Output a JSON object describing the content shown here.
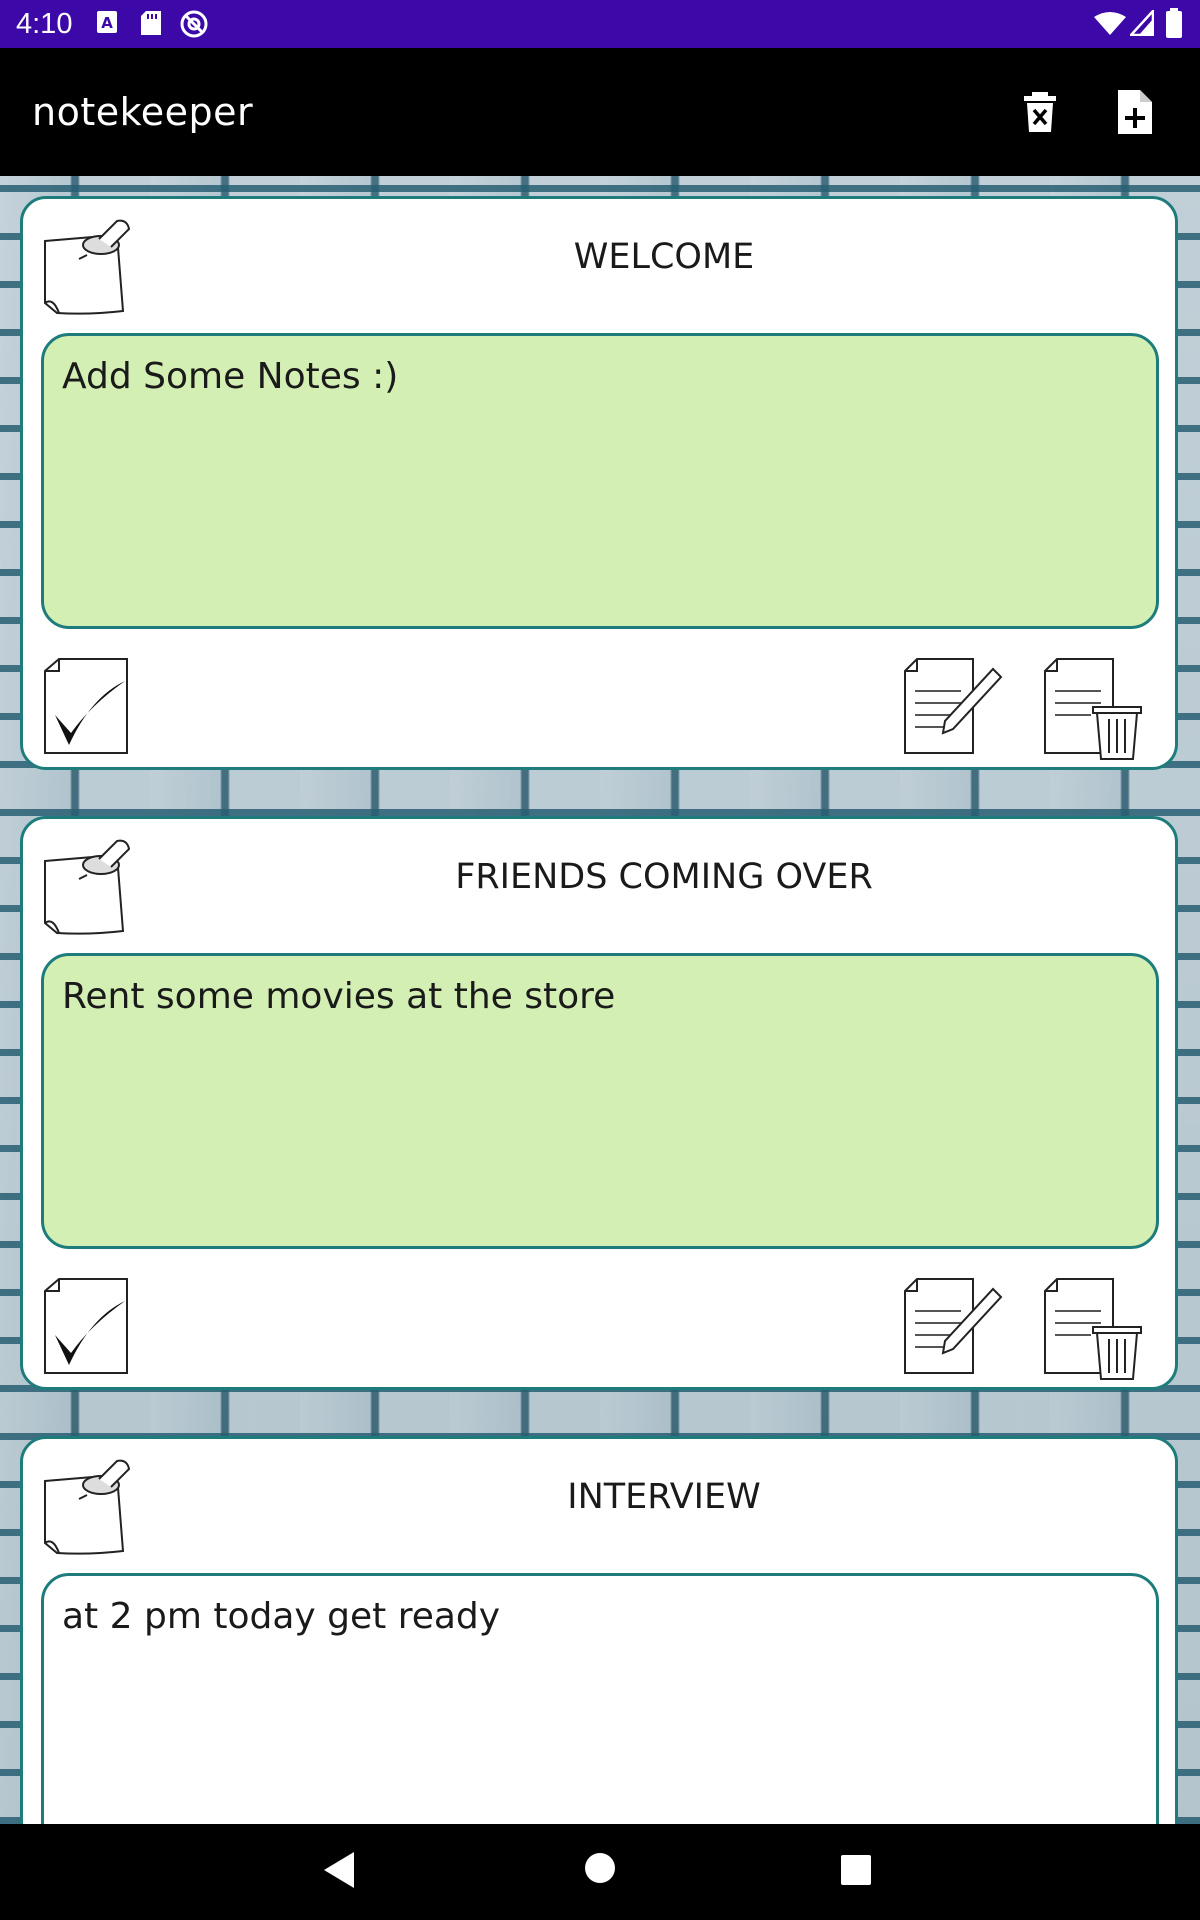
{
  "status_bar": {
    "time": "4:10",
    "left_icons": [
      "text-a-icon",
      "sd-card-icon",
      "at-sign-icon"
    ],
    "right_icons": [
      "wifi-icon",
      "signal-icon",
      "battery-icon"
    ],
    "color": "#3d08a8"
  },
  "app_bar": {
    "title": "notekeeper",
    "actions": [
      "delete-all-icon",
      "add-note-icon"
    ]
  },
  "notes": [
    {
      "title": "WELCOME",
      "body": "Add Some Notes :)",
      "body_color": "#d3efb4"
    },
    {
      "title": "FRIENDS COMING OVER",
      "body": "Rent some movies at the store",
      "body_color": "#d3efb4"
    },
    {
      "title": "INTERVIEW",
      "body": "at 2 pm today get ready",
      "body_color": "#ffffff"
    }
  ],
  "card_actions": [
    "check-done-icon",
    "edit-note-icon",
    "delete-note-icon"
  ],
  "nav_bar": {
    "buttons": [
      "back-icon",
      "home-icon",
      "recents-icon"
    ]
  },
  "colors": {
    "accent_border": "#1e7c7c",
    "note_green": "#d3efb4"
  }
}
